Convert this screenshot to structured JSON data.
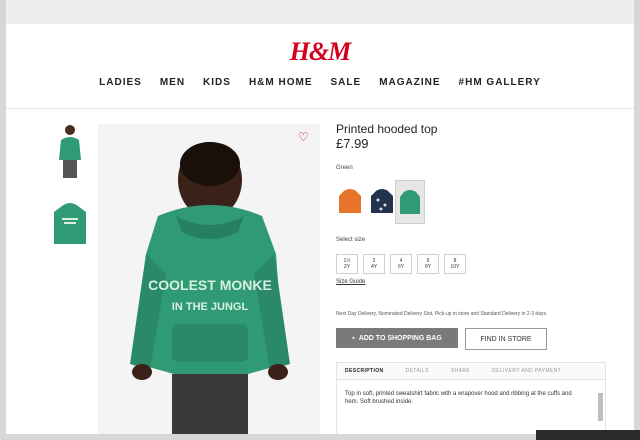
{
  "header": {
    "brand": "H&M",
    "nav": [
      "LADIES",
      "MEN",
      "KIDS",
      "H&M HOME",
      "SALE",
      "MAGAZINE",
      "#HM GALLERY"
    ]
  },
  "product": {
    "title": "Printed hooded top",
    "price": "£7.99",
    "hoodie_print_line1": "COOLEST MONKE",
    "hoodie_print_line2": "IN THE JUNGL",
    "color_label": "Green",
    "swatches": [
      "orange",
      "navy",
      "green"
    ],
    "size_label": "Select size",
    "sizes": [
      {
        "a": "1½",
        "b": "2Y"
      },
      {
        "a": "2",
        "b": "4Y"
      },
      {
        "a": "4",
        "b": "6Y"
      },
      {
        "a": "6",
        "b": "8Y"
      },
      {
        "a": "8",
        "b": "10Y"
      }
    ],
    "size_guide": "Size Guide",
    "delivery_info": "Next Day Delivery, Nominated Delivery Slot, Pick-up in store and Standard Delivery in 2-3 days.",
    "add_to_bag": "ADD TO SHOPPING BAG",
    "find_in_store": "FIND IN STORE",
    "tabs": [
      "DESCRIPTION",
      "DETAILS",
      "SHARE",
      "DELIVERY AND PAYMENT"
    ],
    "description": "Top in soft, printed sweatshirt fabric with a wrapover hood and ribbing at the cuffs and hem. Soft brushed inside."
  },
  "colors": {
    "brand_red": "#d6001c",
    "hoodie_green": "#2f9a73",
    "button_gray": "#7a7a7a"
  }
}
